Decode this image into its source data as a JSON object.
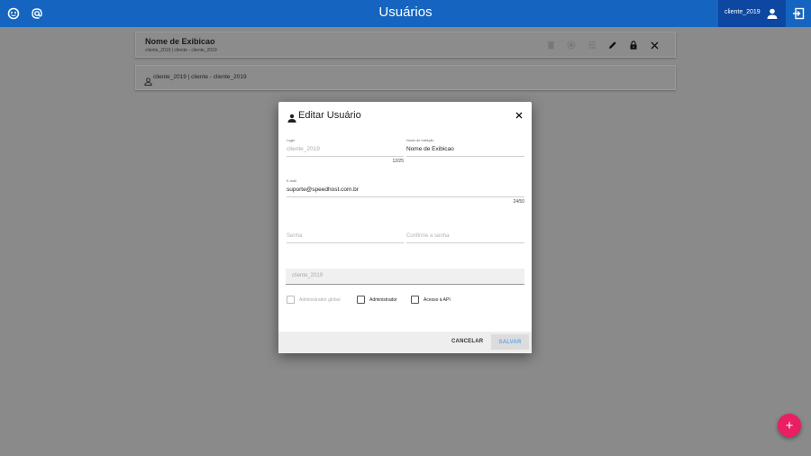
{
  "topbar": {
    "title": "Usuários",
    "left_icons": [
      "logo-icon",
      "at-icon"
    ],
    "user_name": "cliente_2019",
    "user_icon": "person-icon",
    "logout_icon": "logout-icon",
    "color": "#1565c0"
  },
  "header_card": {
    "display_name": "Nome de Exibicao",
    "subtitle": "cliente_2019 | cliente - cliente_2019",
    "actions": [
      "delete-icon",
      "radio-icon",
      "tune-icon",
      "edit-icon",
      "lock-icon",
      "close-icon"
    ]
  },
  "user_row": {
    "icon": "person-outline-icon",
    "text": "cliente_2019 | cliente - cliente_2019"
  },
  "dialog": {
    "title": "Editar Usuário",
    "title_icon": "person-icon",
    "close_icon": "close-icon",
    "login": {
      "label": "Login",
      "value": "cliente_2019",
      "counter": "12/25"
    },
    "display_name": {
      "label": "Nome de exibição",
      "value": "Nome de Exibicao"
    },
    "email": {
      "label": "E-mail",
      "value": "suporte@speedhost.com.br",
      "counter": "24/50"
    },
    "password": {
      "placeholder": "Senha"
    },
    "confirm_password": {
      "placeholder": "Confirme a senha"
    },
    "client_select": {
      "value": "cliente_2019"
    },
    "checkboxes": {
      "global_admin": "Administrador global",
      "admin": "Administrador",
      "api_access": "Acesso à API"
    },
    "cancel_label": "CANCELAR",
    "save_label": "SALVAR"
  },
  "fab": {
    "label": "+",
    "color": "#e91e63"
  }
}
